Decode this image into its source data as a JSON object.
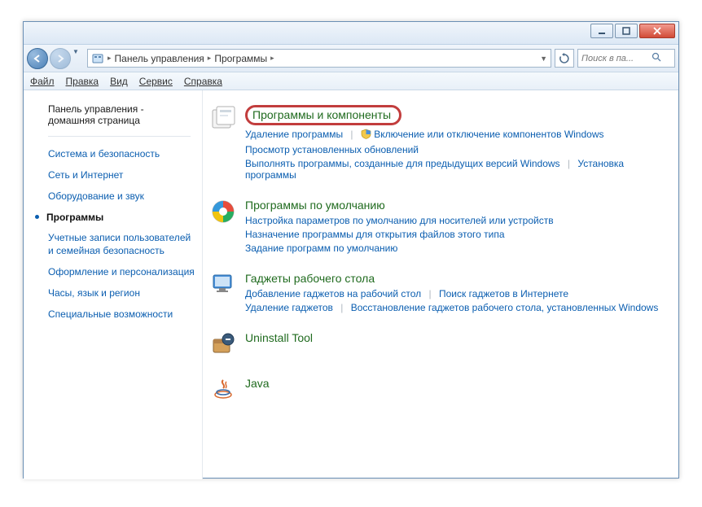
{
  "titlebar": {
    "min_tip": "Свернуть",
    "max_tip": "Развернуть",
    "close_tip": "Закрыть"
  },
  "nav": {
    "back_tip": "Назад",
    "forward_tip": "Вперёд"
  },
  "breadcrumb": {
    "item1": "Панель управления",
    "item2": "Программы"
  },
  "search": {
    "placeholder": "Поиск в па..."
  },
  "menu": {
    "file": "Файл",
    "edit": "Правка",
    "view": "Вид",
    "tools": "Сервис",
    "help": "Справка"
  },
  "sidebar": {
    "home_line1": "Панель управления -",
    "home_line2": "домашняя страница",
    "links": [
      "Система и безопасность",
      "Сеть и Интернет",
      "Оборудование и звук"
    ],
    "current": "Программы",
    "links2": [
      "Учетные записи пользователей и семейная безопасность",
      "Оформление и персонализация",
      "Часы, язык и регион",
      "Специальные возможности"
    ]
  },
  "sections": {
    "s1": {
      "title": "Программы и компоненты",
      "l1": "Удаление программы",
      "l2": "Включение или отключение компонентов Windows",
      "l3": "Просмотр установленных обновлений",
      "l4": "Выполнять программы, созданные для предыдущих версий Windows",
      "l5": "Установка программы"
    },
    "s2": {
      "title": "Программы по умолчанию",
      "l1": "Настройка параметров по умолчанию для носителей или устройств",
      "l2": "Назначение программы для открытия файлов этого типа",
      "l3": "Задание программ по умолчанию"
    },
    "s3": {
      "title": "Гаджеты рабочего стола",
      "l1": "Добавление гаджетов на рабочий стол",
      "l2": "Поиск гаджетов в Интернете",
      "l3": "Удаление гаджетов",
      "l4": "Восстановление гаджетов рабочего стола, установленных Windows"
    },
    "s4": {
      "title": "Uninstall Tool"
    },
    "s5": {
      "title": "Java"
    }
  }
}
